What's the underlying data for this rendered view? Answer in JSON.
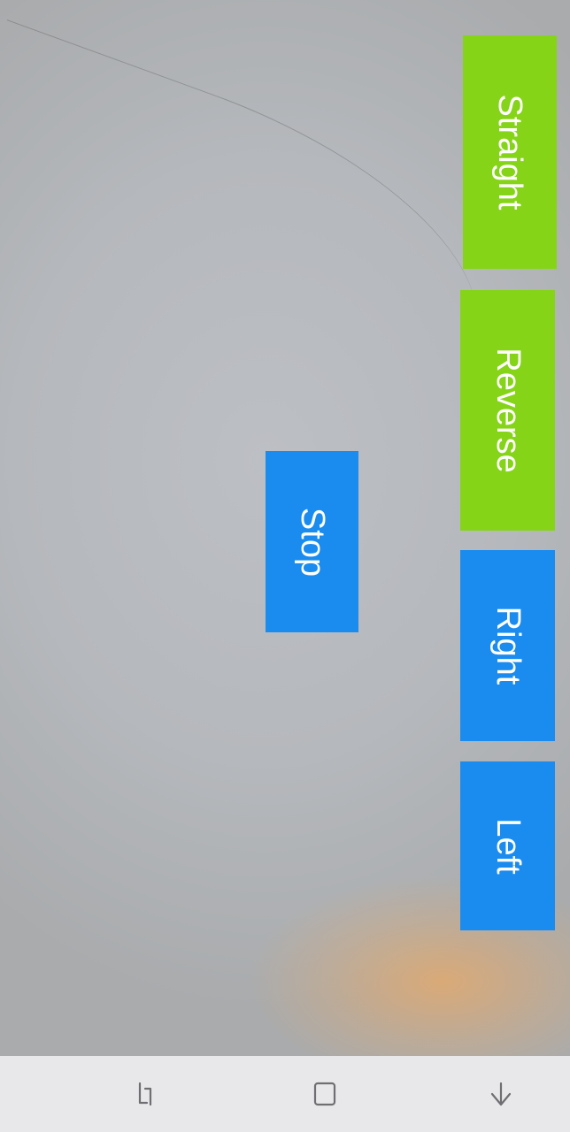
{
  "controls": {
    "straight": {
      "label": "Straight",
      "color": "#86d418"
    },
    "reverse": {
      "label": "Reverse",
      "color": "#86d418"
    },
    "right": {
      "label": "Right",
      "color": "#1a8cf0"
    },
    "left": {
      "label": "Left",
      "color": "#1a8cf0"
    },
    "stop": {
      "label": "Stop",
      "color": "#1a8cf0"
    }
  },
  "navbar": {
    "icons": [
      "recent-apps-icon",
      "home-icon",
      "back-icon"
    ]
  },
  "colors": {
    "green": "#86d418",
    "blue": "#1a8cf0",
    "navbar_bg": "#e8e8ea",
    "screen_bg": "#b5b8bc"
  }
}
